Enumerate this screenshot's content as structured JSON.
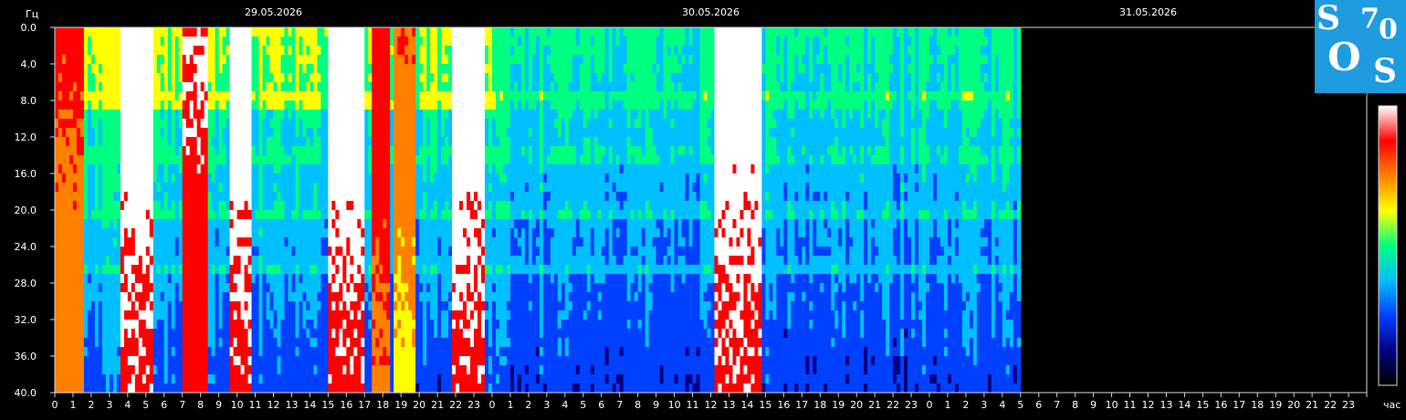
{
  "y_unit": "Гц",
  "x_unit": "час",
  "dates": [
    {
      "label": "29.05.2026",
      "day_start_hour": 0
    },
    {
      "label": "30.05.2026",
      "day_start_hour": 24
    },
    {
      "label": "31.05.2026",
      "day_start_hour": 48
    }
  ],
  "logo": {
    "letters": [
      "S",
      "7",
      "0",
      "O",
      "S"
    ]
  },
  "colorbar": {
    "stops": [
      "#000000",
      "#000080",
      "#0040ff",
      "#00c0ff",
      "#00ff80",
      "#ffff00",
      "#ff8000",
      "#ff0000",
      "#ffffff"
    ]
  },
  "chart_data": {
    "type": "heatmap",
    "x": {
      "range_hours": [
        0,
        72
      ],
      "data_until_hour": 53,
      "tick_labels": [
        "0",
        "1",
        "2",
        "3",
        "4",
        "5",
        "6",
        "7",
        "8",
        "9",
        "10",
        "11",
        "12",
        "13",
        "14",
        "15",
        "16",
        "17",
        "18",
        "19",
        "20",
        "21",
        "22",
        "23"
      ]
    },
    "y": {
      "range": [
        0,
        40
      ],
      "direction": "top-down",
      "tick_labels": [
        "0.0",
        "4.0",
        "8.0",
        "12.0",
        "16.0",
        "20.0",
        "24.0",
        "28.0",
        "32.0",
        "36.0",
        "40.0"
      ]
    },
    "bands_hz": [
      7.8,
      14.1,
      20.3,
      26.4
    ],
    "bright_bursts": [
      {
        "start_h": 0.0,
        "end_h": 1.4,
        "level": 0.85
      },
      {
        "start_h": 3.6,
        "end_h": 5.3,
        "level": 1.0
      },
      {
        "start_h": 6.9,
        "end_h": 8.3,
        "level": 0.95
      },
      {
        "start_h": 9.5,
        "end_h": 10.6,
        "level": 1.0
      },
      {
        "start_h": 14.8,
        "end_h": 16.9,
        "level": 1.0
      },
      {
        "start_h": 17.2,
        "end_h": 18.3,
        "level": 0.9
      },
      {
        "start_h": 18.4,
        "end_h": 19.6,
        "level": 0.8
      },
      {
        "start_h": 21.7,
        "end_h": 23.4,
        "level": 1.0
      },
      {
        "start_h": 36.1,
        "end_h": 38.8,
        "level": 1.0
      }
    ]
  }
}
